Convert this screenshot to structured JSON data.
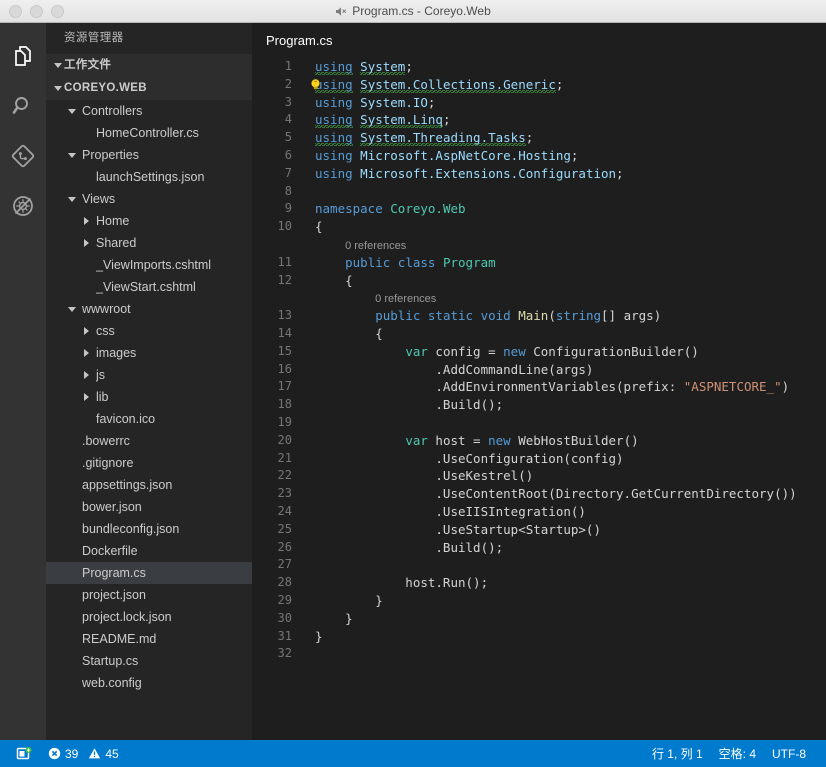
{
  "window": {
    "title": "Program.cs - Coreyo.Web",
    "title_icon": "muted-speaker-icon",
    "traffic_lights": [
      "close",
      "minimize",
      "zoom"
    ]
  },
  "activity_bar": {
    "items": [
      {
        "icon": "files-explorer-icon",
        "name": "explorer",
        "active": true
      },
      {
        "icon": "search-icon",
        "name": "search",
        "active": false
      },
      {
        "icon": "source-control-icon",
        "name": "source-control",
        "active": false
      },
      {
        "icon": "debug-no-icon",
        "name": "debug",
        "active": false
      }
    ]
  },
  "sidebar": {
    "title": "资源管理器",
    "sections": [
      {
        "label": "工作文件",
        "expanded": true
      },
      {
        "label": "COREYO.WEB",
        "expanded": true
      }
    ],
    "tree": [
      {
        "label": "Controllers",
        "indent": 1,
        "type": "folder",
        "expanded": true,
        "selected": false
      },
      {
        "label": "HomeController.cs",
        "indent": 2,
        "type": "file",
        "selected": false
      },
      {
        "label": "Properties",
        "indent": 1,
        "type": "folder",
        "expanded": true,
        "selected": false
      },
      {
        "label": "launchSettings.json",
        "indent": 2,
        "type": "file",
        "selected": false
      },
      {
        "label": "Views",
        "indent": 1,
        "type": "folder",
        "expanded": true,
        "selected": false
      },
      {
        "label": "Home",
        "indent": 2,
        "type": "folder",
        "expanded": false,
        "selected": false
      },
      {
        "label": "Shared",
        "indent": 2,
        "type": "folder",
        "expanded": false,
        "selected": false
      },
      {
        "label": "_ViewImports.cshtml",
        "indent": 2,
        "type": "file",
        "selected": false
      },
      {
        "label": "_ViewStart.cshtml",
        "indent": 2,
        "type": "file",
        "selected": false
      },
      {
        "label": "wwwroot",
        "indent": 1,
        "type": "folder",
        "expanded": true,
        "selected": false
      },
      {
        "label": "css",
        "indent": 2,
        "type": "folder",
        "expanded": false,
        "selected": false
      },
      {
        "label": "images",
        "indent": 2,
        "type": "folder",
        "expanded": false,
        "selected": false
      },
      {
        "label": "js",
        "indent": 2,
        "type": "folder",
        "expanded": false,
        "selected": false
      },
      {
        "label": "lib",
        "indent": 2,
        "type": "folder",
        "expanded": false,
        "selected": false
      },
      {
        "label": "favicon.ico",
        "indent": 2,
        "type": "file",
        "selected": false
      },
      {
        "label": ".bowerrc",
        "indent": 1,
        "type": "file",
        "selected": false
      },
      {
        "label": ".gitignore",
        "indent": 1,
        "type": "file",
        "selected": false
      },
      {
        "label": "appsettings.json",
        "indent": 1,
        "type": "file",
        "selected": false
      },
      {
        "label": "bower.json",
        "indent": 1,
        "type": "file",
        "selected": false
      },
      {
        "label": "bundleconfig.json",
        "indent": 1,
        "type": "file",
        "selected": false
      },
      {
        "label": "Dockerfile",
        "indent": 1,
        "type": "file",
        "selected": false
      },
      {
        "label": "Program.cs",
        "indent": 1,
        "type": "file",
        "selected": true
      },
      {
        "label": "project.json",
        "indent": 1,
        "type": "file",
        "selected": false
      },
      {
        "label": "project.lock.json",
        "indent": 1,
        "type": "file",
        "selected": false
      },
      {
        "label": "README.md",
        "indent": 1,
        "type": "file",
        "selected": false
      },
      {
        "label": "Startup.cs",
        "indent": 1,
        "type": "file",
        "selected": false
      },
      {
        "label": "web.config",
        "indent": 1,
        "type": "file",
        "selected": false
      }
    ]
  },
  "editor": {
    "tabs": [
      {
        "label": "Program.cs",
        "active": true
      }
    ],
    "language": "csharp",
    "codelens_label": "0 references",
    "lines": [
      {
        "n": 1,
        "tokens": [
          {
            "t": "using",
            "c": "k",
            "squiggly": true
          },
          {
            "t": " ",
            "c": "plain"
          },
          {
            "t": "System",
            "c": "ns",
            "squiggly": true
          },
          {
            "t": ";",
            "c": "plain"
          }
        ]
      },
      {
        "n": 2,
        "bulb": true,
        "tokens": [
          {
            "t": "using",
            "c": "k",
            "squiggly": true
          },
          {
            "t": " ",
            "c": "plain"
          },
          {
            "t": "System.Collections.Generic",
            "c": "ns",
            "squiggly": true
          },
          {
            "t": ";",
            "c": "plain"
          }
        ]
      },
      {
        "n": 3,
        "tokens": [
          {
            "t": "using",
            "c": "k"
          },
          {
            "t": " ",
            "c": "plain"
          },
          {
            "t": "System.IO",
            "c": "ns"
          },
          {
            "t": ";",
            "c": "plain"
          }
        ]
      },
      {
        "n": 4,
        "tokens": [
          {
            "t": "using",
            "c": "k",
            "squiggly": true
          },
          {
            "t": " ",
            "c": "plain"
          },
          {
            "t": "System.Linq",
            "c": "ns",
            "squiggly": true
          },
          {
            "t": ";",
            "c": "plain"
          }
        ]
      },
      {
        "n": 5,
        "tokens": [
          {
            "t": "using",
            "c": "k",
            "squiggly": true
          },
          {
            "t": " ",
            "c": "plain"
          },
          {
            "t": "System.Threading.Tasks",
            "c": "ns",
            "squiggly": true
          },
          {
            "t": ";",
            "c": "plain"
          }
        ]
      },
      {
        "n": 6,
        "tokens": [
          {
            "t": "using",
            "c": "k"
          },
          {
            "t": " ",
            "c": "plain"
          },
          {
            "t": "Microsoft.AspNetCore.Hosting",
            "c": "ns"
          },
          {
            "t": ";",
            "c": "plain"
          }
        ]
      },
      {
        "n": 7,
        "tokens": [
          {
            "t": "using",
            "c": "k"
          },
          {
            "t": " ",
            "c": "plain"
          },
          {
            "t": "Microsoft.Extensions.Configuration",
            "c": "ns"
          },
          {
            "t": ";",
            "c": "plain"
          }
        ]
      },
      {
        "n": 8,
        "tokens": []
      },
      {
        "n": 9,
        "tokens": [
          {
            "t": "namespace",
            "c": "k"
          },
          {
            "t": " ",
            "c": "plain"
          },
          {
            "t": "Coreyo.Web",
            "c": "t"
          }
        ]
      },
      {
        "n": 10,
        "tokens": [
          {
            "t": "{",
            "c": "plain"
          }
        ]
      },
      {
        "lens": "0 references",
        "lens_indent": 4
      },
      {
        "n": 11,
        "tokens": [
          {
            "t": "    ",
            "c": "plain"
          },
          {
            "t": "public",
            "c": "k"
          },
          {
            "t": " ",
            "c": "plain"
          },
          {
            "t": "class",
            "c": "k"
          },
          {
            "t": " ",
            "c": "plain"
          },
          {
            "t": "Program",
            "c": "t"
          }
        ]
      },
      {
        "n": 12,
        "tokens": [
          {
            "t": "    {",
            "c": "plain"
          }
        ]
      },
      {
        "lens": "0 references",
        "lens_indent": 8
      },
      {
        "n": 13,
        "tokens": [
          {
            "t": "        ",
            "c": "plain"
          },
          {
            "t": "public",
            "c": "k"
          },
          {
            "t": " ",
            "c": "plain"
          },
          {
            "t": "static",
            "c": "k"
          },
          {
            "t": " ",
            "c": "plain"
          },
          {
            "t": "void",
            "c": "k"
          },
          {
            "t": " ",
            "c": "plain"
          },
          {
            "t": "Main",
            "c": "fn"
          },
          {
            "t": "(",
            "c": "plain"
          },
          {
            "t": "string",
            "c": "k"
          },
          {
            "t": "[] args)",
            "c": "plain"
          }
        ]
      },
      {
        "n": 14,
        "tokens": [
          {
            "t": "        {",
            "c": "plain"
          }
        ]
      },
      {
        "n": 15,
        "tokens": [
          {
            "t": "            ",
            "c": "plain"
          },
          {
            "t": "var",
            "c": "ctrl"
          },
          {
            "t": " config = ",
            "c": "plain"
          },
          {
            "t": "new",
            "c": "k"
          },
          {
            "t": " ConfigurationBuilder()",
            "c": "plain"
          }
        ]
      },
      {
        "n": 16,
        "tokens": [
          {
            "t": "                .AddCommandLine(args)",
            "c": "plain"
          }
        ]
      },
      {
        "n": 17,
        "tokens": [
          {
            "t": "                .AddEnvironmentVariables(prefix: ",
            "c": "plain"
          },
          {
            "t": "\"ASPNETCORE_\"",
            "c": "str"
          },
          {
            "t": ")",
            "c": "plain"
          }
        ]
      },
      {
        "n": 18,
        "tokens": [
          {
            "t": "                .Build();",
            "c": "plain"
          }
        ]
      },
      {
        "n": 19,
        "tokens": []
      },
      {
        "n": 20,
        "tokens": [
          {
            "t": "            ",
            "c": "plain"
          },
          {
            "t": "var",
            "c": "ctrl"
          },
          {
            "t": " host = ",
            "c": "plain"
          },
          {
            "t": "new",
            "c": "k"
          },
          {
            "t": " WebHostBuilder()",
            "c": "plain"
          }
        ]
      },
      {
        "n": 21,
        "tokens": [
          {
            "t": "                .UseConfiguration(config)",
            "c": "plain"
          }
        ]
      },
      {
        "n": 22,
        "tokens": [
          {
            "t": "                .UseKestrel()",
            "c": "plain"
          }
        ]
      },
      {
        "n": 23,
        "tokens": [
          {
            "t": "                .UseContentRoot(Directory.GetCurrentDirectory())",
            "c": "plain"
          }
        ]
      },
      {
        "n": 24,
        "tokens": [
          {
            "t": "                .UseIISIntegration()",
            "c": "plain"
          }
        ]
      },
      {
        "n": 25,
        "tokens": [
          {
            "t": "                .UseStartup<Startup>()",
            "c": "plain"
          }
        ]
      },
      {
        "n": 26,
        "tokens": [
          {
            "t": "                .Build();",
            "c": "plain"
          }
        ]
      },
      {
        "n": 27,
        "tokens": []
      },
      {
        "n": 28,
        "tokens": [
          {
            "t": "            host.Run();",
            "c": "plain"
          }
        ]
      },
      {
        "n": 29,
        "tokens": [
          {
            "t": "        }",
            "c": "plain"
          }
        ]
      },
      {
        "n": 30,
        "tokens": [
          {
            "t": "    }",
            "c": "plain"
          }
        ]
      },
      {
        "n": 31,
        "tokens": [
          {
            "t": "}",
            "c": "plain"
          }
        ]
      },
      {
        "n": 32,
        "tokens": []
      }
    ]
  },
  "status_bar": {
    "background": "#007acc",
    "remote_icon": "remote-window-icon",
    "errors_icon": "error-circle-icon",
    "errors": "39",
    "warnings_icon": "warning-triangle-icon",
    "warnings": "45",
    "cursor_position": "行 1, 列 1",
    "indentation": "空格: 4",
    "encoding": "UTF-8"
  }
}
